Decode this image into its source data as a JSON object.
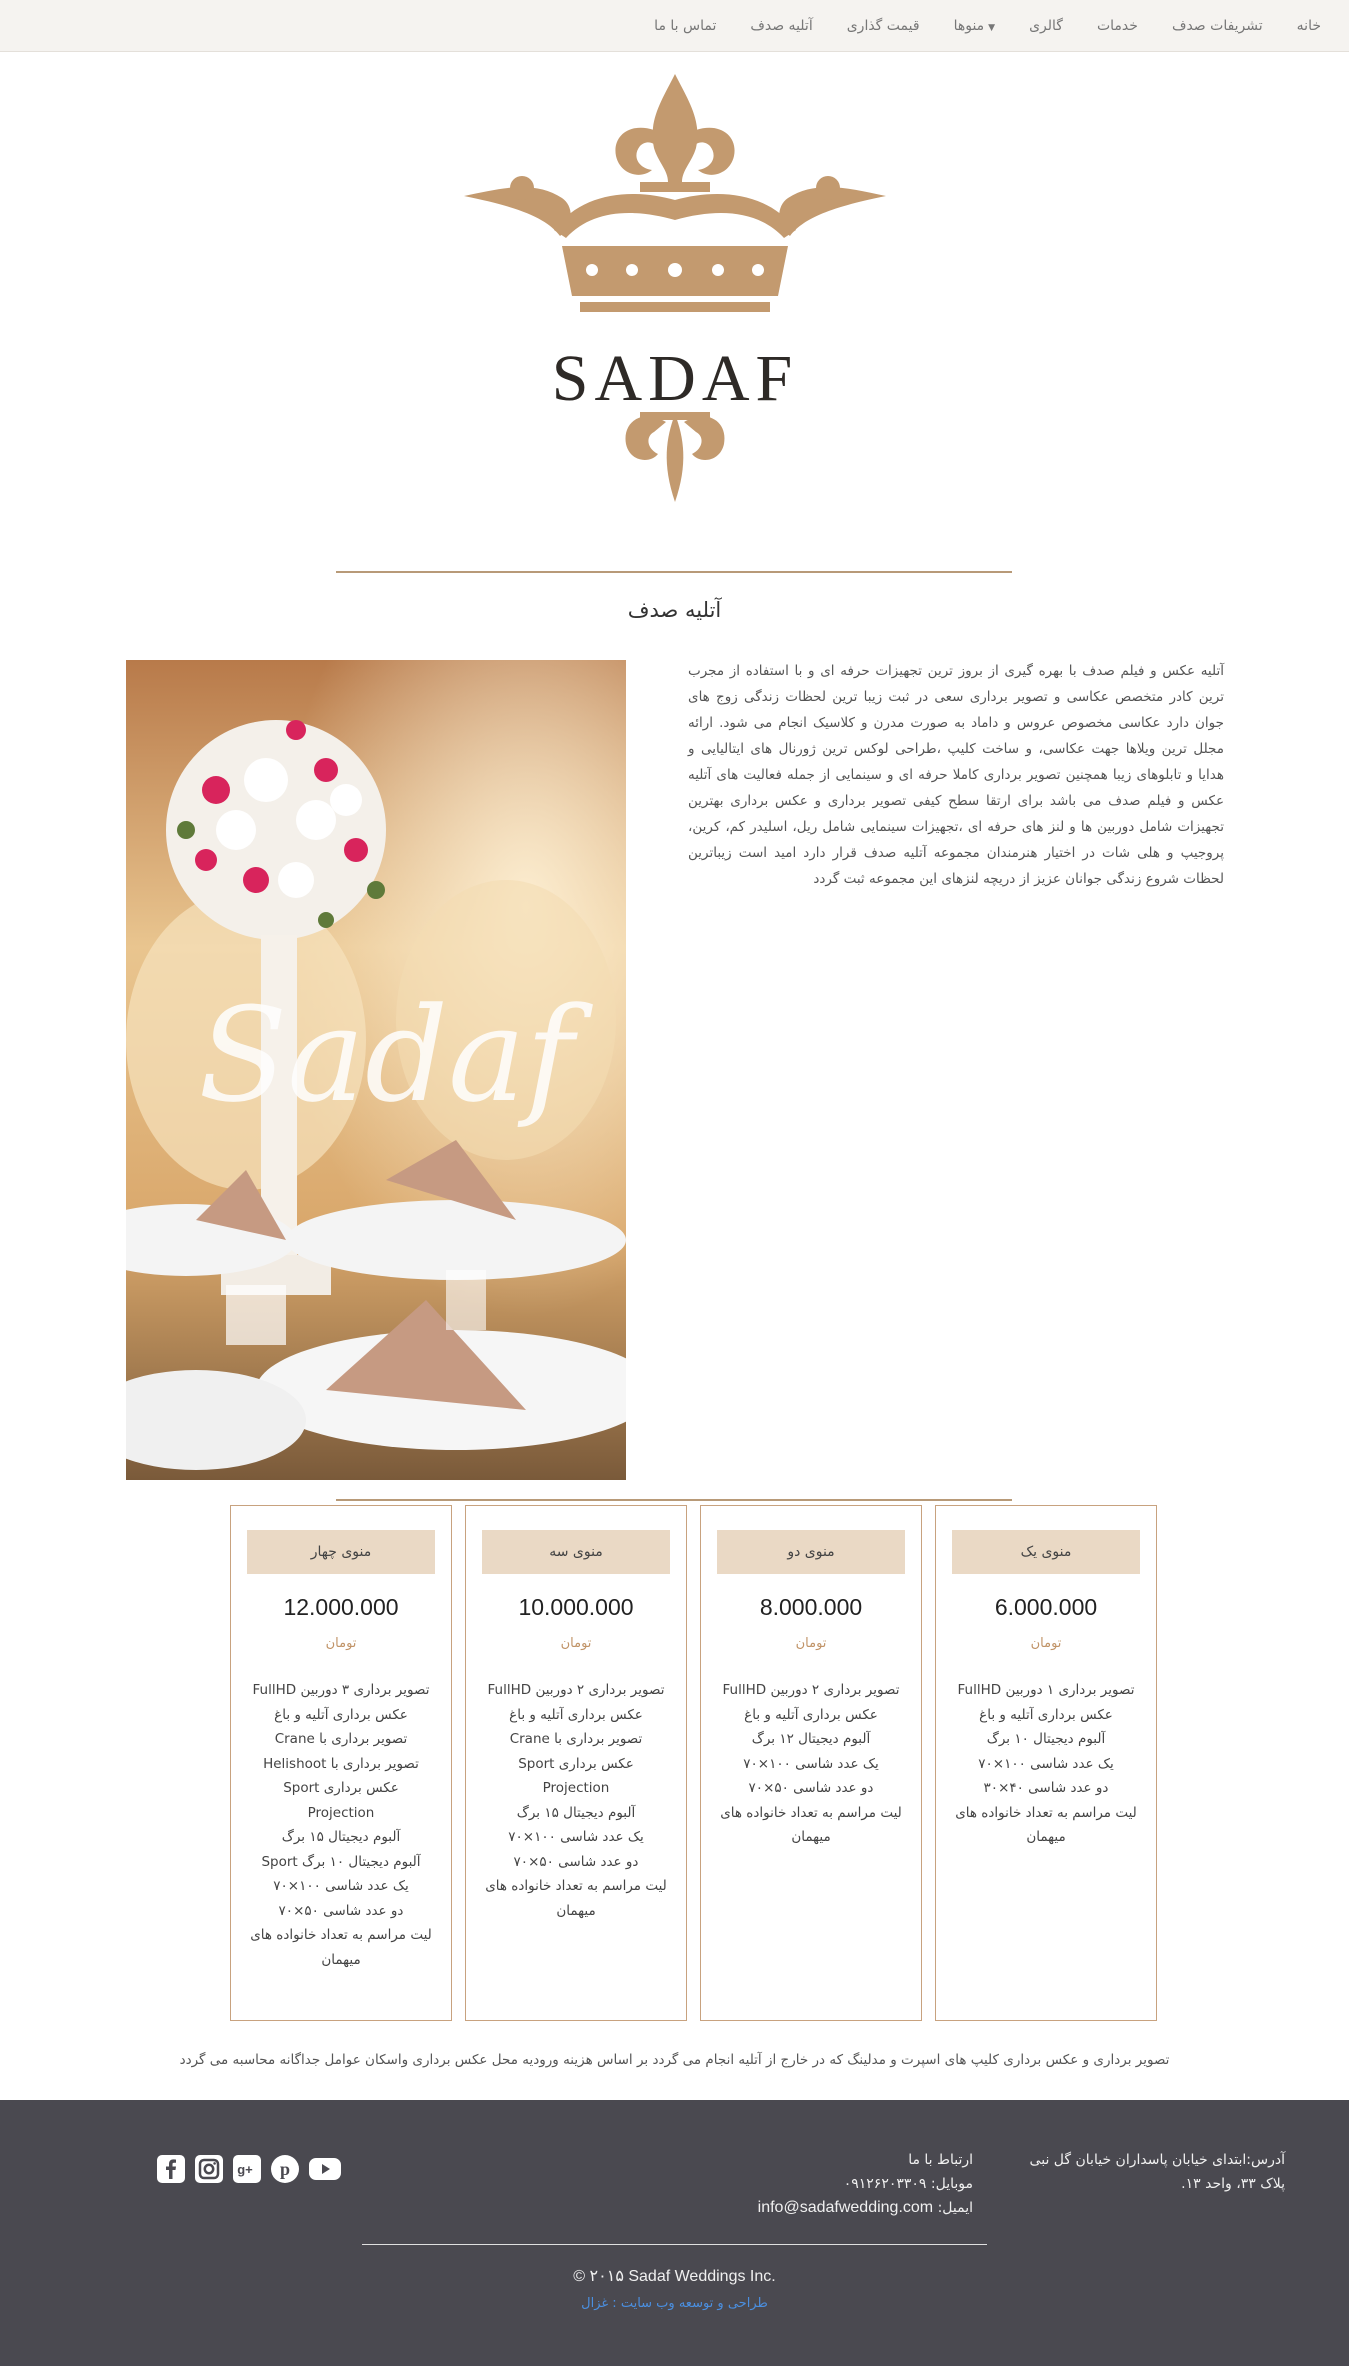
{
  "nav": {
    "items": [
      "خانه",
      "تشریفات صدف",
      "خدمات",
      "گالری",
      "منوها",
      "قیمت گذاری",
      "آتلیه صدف",
      "تماس با ما"
    ]
  },
  "logo": {
    "text": "SADAF"
  },
  "about": {
    "title": "آتلیه صدف",
    "text": "آتلیه عکس و فیلم صدف با بهره گیری از بروز ترین تجهیزات حرفه ای و با استفاده از مجرب ترین کادر متخصص عکاسی و تصویر برداری سعی در ثبت زیبا ترین لحظات زندگی زوج های جوان دارد عکاسی مخصوص عروس و داماد به صورت مدرن و کلاسیک انجام می شود. ارائه مجلل ترین ویلاها جهت عکاسی، و ساخت کلیپ ،طراحی لوکس ترین ژورنال های ایتالیایی و هدایا و تابلوهای زیبا همچنین تصویر برداری کاملا حرفه ای و سینمایی از جمله فعالیت های آتلیه عکس و فیلم صدف می باشد برای ارتقا سطح کیفی تصویر برداری و عکس برداری بهترین تجهیزات شامل دوربین ها و لنز های حرفه ای ،تجهیزات سینمایی شامل ریل، اسلیدر کم، کرین، پروجیپ و هلی شات در اختیار هنرمندان مجموعه آتلیه صدف قرار دارد امید است زیباترین لحظات شروع زندگی جوانان عزیز از دریچه لنزهای این مجموعه ثبت گردد",
    "photo_text": "Sadaf"
  },
  "pricing": {
    "cards": [
      {
        "name": "منوی یک",
        "price": "6.000.000",
        "unit": "تومان",
        "features": [
          "تصویر برداری ۱ دوربین FullHD",
          "عکس برداری آتلیه و باغ",
          "آلبوم دیجیتال ۱۰ برگ",
          "یک عدد شاسی ۱۰۰×۷۰",
          "دو عدد شاسی ۴۰×۳۰",
          "لیت مراسم به تعداد خانواده های میهمان"
        ]
      },
      {
        "name": "منوی دو",
        "price": "8.000.000",
        "unit": "تومان",
        "features": [
          "تصویر برداری ۲ دوربین FullHD",
          "عکس برداری آتلیه و باغ",
          "آلبوم دیجیتال ۱۲ برگ",
          "یک عدد شاسی ۱۰۰×۷۰",
          "دو عدد شاسی ۵۰×۷۰",
          "لیت مراسم به تعداد خانواده های میهمان"
        ]
      },
      {
        "name": "منوی سه",
        "price": "10.000.000",
        "unit": "تومان",
        "features": [
          "تصویر برداری ۲ دوربین FullHD",
          "عکس برداری آتلیه و باغ",
          "تصویر برداری با Crane",
          "عکس برداری Sport",
          "Projection",
          "آلبوم دیجیتال ۱۵ برگ",
          "یک عدد شاسی ۱۰۰×۷۰",
          "دو عدد شاسی ۵۰×۷۰",
          "لیت مراسم به تعداد خانواده های میهمان"
        ]
      },
      {
        "name": "منوی چهار",
        "price": "12.000.000",
        "unit": "تومان",
        "features": [
          "تصویر برداری ۳ دوربین FullHD",
          "عکس برداری آتلیه و باغ",
          "تصویر برداری با Crane",
          "تصویر برداری با Helishoot",
          "عکس برداری Sport",
          "Projection",
          "آلبوم دیجیتال ۱۵ برگ",
          "آلبوم دیجیتال ۱۰ برگ Sport",
          "یک عدد شاسی ۱۰۰×۷۰",
          "دو عدد شاسی ۵۰×۷۰",
          "لیت مراسم به تعداد خانواده های میهمان"
        ]
      }
    ]
  },
  "note": "تصویر برداری و عکس برداری کلیپ های اسپرت و مدلینگ که در خارج از آتلیه انجام می گردد بر اساس هزینه ورودیه محل عکس برداری واسکان عوامل جداگانه محاسبه می گردد",
  "footer": {
    "address_line1": "آدرس:ابتدای خیابان پاسداران خیابان گل نبی",
    "address_line2": "پلاک ۳۳، واحد ۱۳.",
    "contact_title": "ارتباط با ما",
    "mobile": "موبایل: ۰۹۱۲۶۲۰۳۳۰۹",
    "email_label": "ایمیل:",
    "email": "info@sadafwedding.com",
    "copyright": "© ۲۰۱۵ Sadaf Weddings Inc.",
    "designer": "طراحی و توسعه وب سایت : غزال",
    "social": [
      "facebook-icon",
      "instagram-icon",
      "google-plus-icon",
      "pinterest-icon",
      "youtube-icon"
    ]
  },
  "colors": {
    "accent": "#c19468",
    "card_head": "#ead9c5",
    "footer_bg": "#4a4950",
    "link": "#4a8fe0"
  }
}
